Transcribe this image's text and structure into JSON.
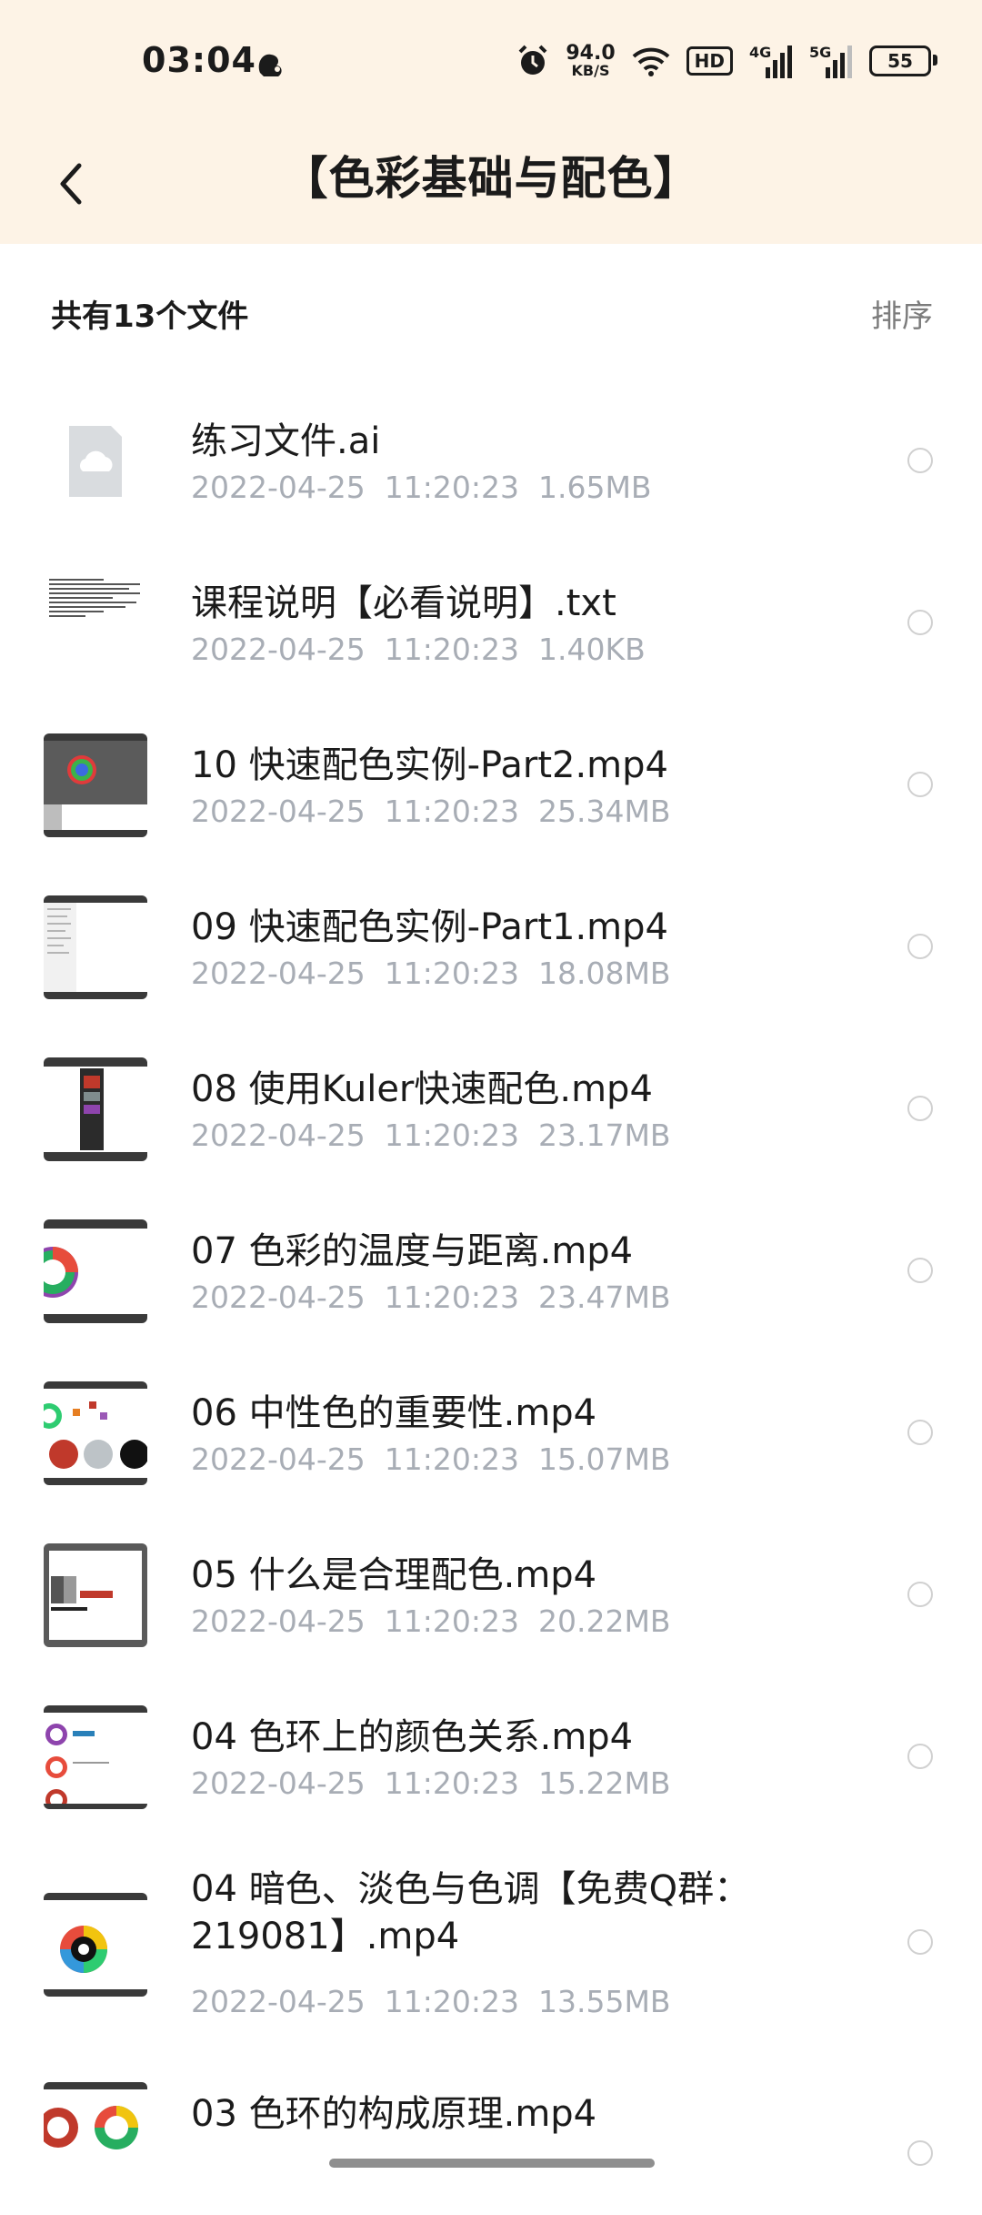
{
  "status": {
    "time": "03:04",
    "net_speed_value": "94.0",
    "net_speed_unit": "KB/S",
    "hd_label": "HD",
    "signal1_label": "4G",
    "signal2_label": "5G",
    "battery": "55"
  },
  "header": {
    "title": "【色彩基础与配色】"
  },
  "summary": {
    "count": "共有13个文件",
    "sort_label": "排序"
  },
  "files": [
    {
      "name": "练习文件.ai",
      "date": "2022-04-25  11:20:23",
      "size": "1.65MB",
      "thumb": "cloud-file"
    },
    {
      "name": "课程说明【必看说明】.txt",
      "date": "2022-04-25  11:20:23",
      "size": "1.40KB",
      "thumb": "text-doc"
    },
    {
      "name": "10 快速配色实例-Part2.mp4",
      "date": "2022-04-25  11:20:23",
      "size": "25.34MB",
      "thumb": "video-colorpicker"
    },
    {
      "name": "09 快速配色实例-Part1.mp4",
      "date": "2022-04-25  11:20:23",
      "size": "18.08MB",
      "thumb": "video-panel"
    },
    {
      "name": "08 使用Kuler快速配色.mp4",
      "date": "2022-04-25  11:20:23",
      "size": "23.17MB",
      "thumb": "video-dark-panel"
    },
    {
      "name": "07 色彩的温度与距离.mp4",
      "date": "2022-04-25  11:20:23",
      "size": "23.47MB",
      "thumb": "video-colorwheel"
    },
    {
      "name": "06 中性色的重要性.mp4",
      "date": "2022-04-25  11:20:23",
      "size": "15.07MB",
      "thumb": "video-wheels"
    },
    {
      "name": "05 什么是合理配色.mp4",
      "date": "2022-04-25  11:20:23",
      "size": "20.22MB",
      "thumb": "video-chromatic"
    },
    {
      "name": "04 色环上的颜色关系.mp4",
      "date": "2022-04-25  11:20:23",
      "size": "15.22MB",
      "thumb": "video-wheel-list"
    },
    {
      "name": "04 暗色、淡色与色调【免费Q群：219081】.mp4",
      "date": "2022-04-25  11:20:23",
      "size": "13.55MB",
      "thumb": "video-wheel-single"
    },
    {
      "name": "03 色环的构成原理.mp4",
      "date": "",
      "size": "",
      "thumb": "video-two-wheels"
    }
  ]
}
